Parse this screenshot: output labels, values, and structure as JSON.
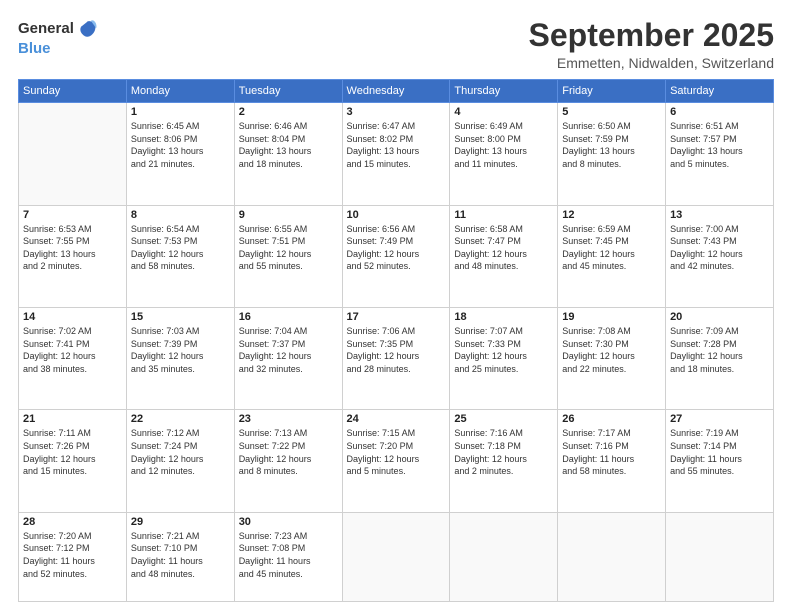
{
  "header": {
    "logo_general": "General",
    "logo_blue": "Blue",
    "month": "September 2025",
    "location": "Emmetten, Nidwalden, Switzerland"
  },
  "weekdays": [
    "Sunday",
    "Monday",
    "Tuesday",
    "Wednesday",
    "Thursday",
    "Friday",
    "Saturday"
  ],
  "weeks": [
    [
      {
        "day": "",
        "info": ""
      },
      {
        "day": "1",
        "info": "Sunrise: 6:45 AM\nSunset: 8:06 PM\nDaylight: 13 hours\nand 21 minutes."
      },
      {
        "day": "2",
        "info": "Sunrise: 6:46 AM\nSunset: 8:04 PM\nDaylight: 13 hours\nand 18 minutes."
      },
      {
        "day": "3",
        "info": "Sunrise: 6:47 AM\nSunset: 8:02 PM\nDaylight: 13 hours\nand 15 minutes."
      },
      {
        "day": "4",
        "info": "Sunrise: 6:49 AM\nSunset: 8:00 PM\nDaylight: 13 hours\nand 11 minutes."
      },
      {
        "day": "5",
        "info": "Sunrise: 6:50 AM\nSunset: 7:59 PM\nDaylight: 13 hours\nand 8 minutes."
      },
      {
        "day": "6",
        "info": "Sunrise: 6:51 AM\nSunset: 7:57 PM\nDaylight: 13 hours\nand 5 minutes."
      }
    ],
    [
      {
        "day": "7",
        "info": "Sunrise: 6:53 AM\nSunset: 7:55 PM\nDaylight: 13 hours\nand 2 minutes."
      },
      {
        "day": "8",
        "info": "Sunrise: 6:54 AM\nSunset: 7:53 PM\nDaylight: 12 hours\nand 58 minutes."
      },
      {
        "day": "9",
        "info": "Sunrise: 6:55 AM\nSunset: 7:51 PM\nDaylight: 12 hours\nand 55 minutes."
      },
      {
        "day": "10",
        "info": "Sunrise: 6:56 AM\nSunset: 7:49 PM\nDaylight: 12 hours\nand 52 minutes."
      },
      {
        "day": "11",
        "info": "Sunrise: 6:58 AM\nSunset: 7:47 PM\nDaylight: 12 hours\nand 48 minutes."
      },
      {
        "day": "12",
        "info": "Sunrise: 6:59 AM\nSunset: 7:45 PM\nDaylight: 12 hours\nand 45 minutes."
      },
      {
        "day": "13",
        "info": "Sunrise: 7:00 AM\nSunset: 7:43 PM\nDaylight: 12 hours\nand 42 minutes."
      }
    ],
    [
      {
        "day": "14",
        "info": "Sunrise: 7:02 AM\nSunset: 7:41 PM\nDaylight: 12 hours\nand 38 minutes."
      },
      {
        "day": "15",
        "info": "Sunrise: 7:03 AM\nSunset: 7:39 PM\nDaylight: 12 hours\nand 35 minutes."
      },
      {
        "day": "16",
        "info": "Sunrise: 7:04 AM\nSunset: 7:37 PM\nDaylight: 12 hours\nand 32 minutes."
      },
      {
        "day": "17",
        "info": "Sunrise: 7:06 AM\nSunset: 7:35 PM\nDaylight: 12 hours\nand 28 minutes."
      },
      {
        "day": "18",
        "info": "Sunrise: 7:07 AM\nSunset: 7:33 PM\nDaylight: 12 hours\nand 25 minutes."
      },
      {
        "day": "19",
        "info": "Sunrise: 7:08 AM\nSunset: 7:30 PM\nDaylight: 12 hours\nand 22 minutes."
      },
      {
        "day": "20",
        "info": "Sunrise: 7:09 AM\nSunset: 7:28 PM\nDaylight: 12 hours\nand 18 minutes."
      }
    ],
    [
      {
        "day": "21",
        "info": "Sunrise: 7:11 AM\nSunset: 7:26 PM\nDaylight: 12 hours\nand 15 minutes."
      },
      {
        "day": "22",
        "info": "Sunrise: 7:12 AM\nSunset: 7:24 PM\nDaylight: 12 hours\nand 12 minutes."
      },
      {
        "day": "23",
        "info": "Sunrise: 7:13 AM\nSunset: 7:22 PM\nDaylight: 12 hours\nand 8 minutes."
      },
      {
        "day": "24",
        "info": "Sunrise: 7:15 AM\nSunset: 7:20 PM\nDaylight: 12 hours\nand 5 minutes."
      },
      {
        "day": "25",
        "info": "Sunrise: 7:16 AM\nSunset: 7:18 PM\nDaylight: 12 hours\nand 2 minutes."
      },
      {
        "day": "26",
        "info": "Sunrise: 7:17 AM\nSunset: 7:16 PM\nDaylight: 11 hours\nand 58 minutes."
      },
      {
        "day": "27",
        "info": "Sunrise: 7:19 AM\nSunset: 7:14 PM\nDaylight: 11 hours\nand 55 minutes."
      }
    ],
    [
      {
        "day": "28",
        "info": "Sunrise: 7:20 AM\nSunset: 7:12 PM\nDaylight: 11 hours\nand 52 minutes."
      },
      {
        "day": "29",
        "info": "Sunrise: 7:21 AM\nSunset: 7:10 PM\nDaylight: 11 hours\nand 48 minutes."
      },
      {
        "day": "30",
        "info": "Sunrise: 7:23 AM\nSunset: 7:08 PM\nDaylight: 11 hours\nand 45 minutes."
      },
      {
        "day": "",
        "info": ""
      },
      {
        "day": "",
        "info": ""
      },
      {
        "day": "",
        "info": ""
      },
      {
        "day": "",
        "info": ""
      }
    ]
  ]
}
